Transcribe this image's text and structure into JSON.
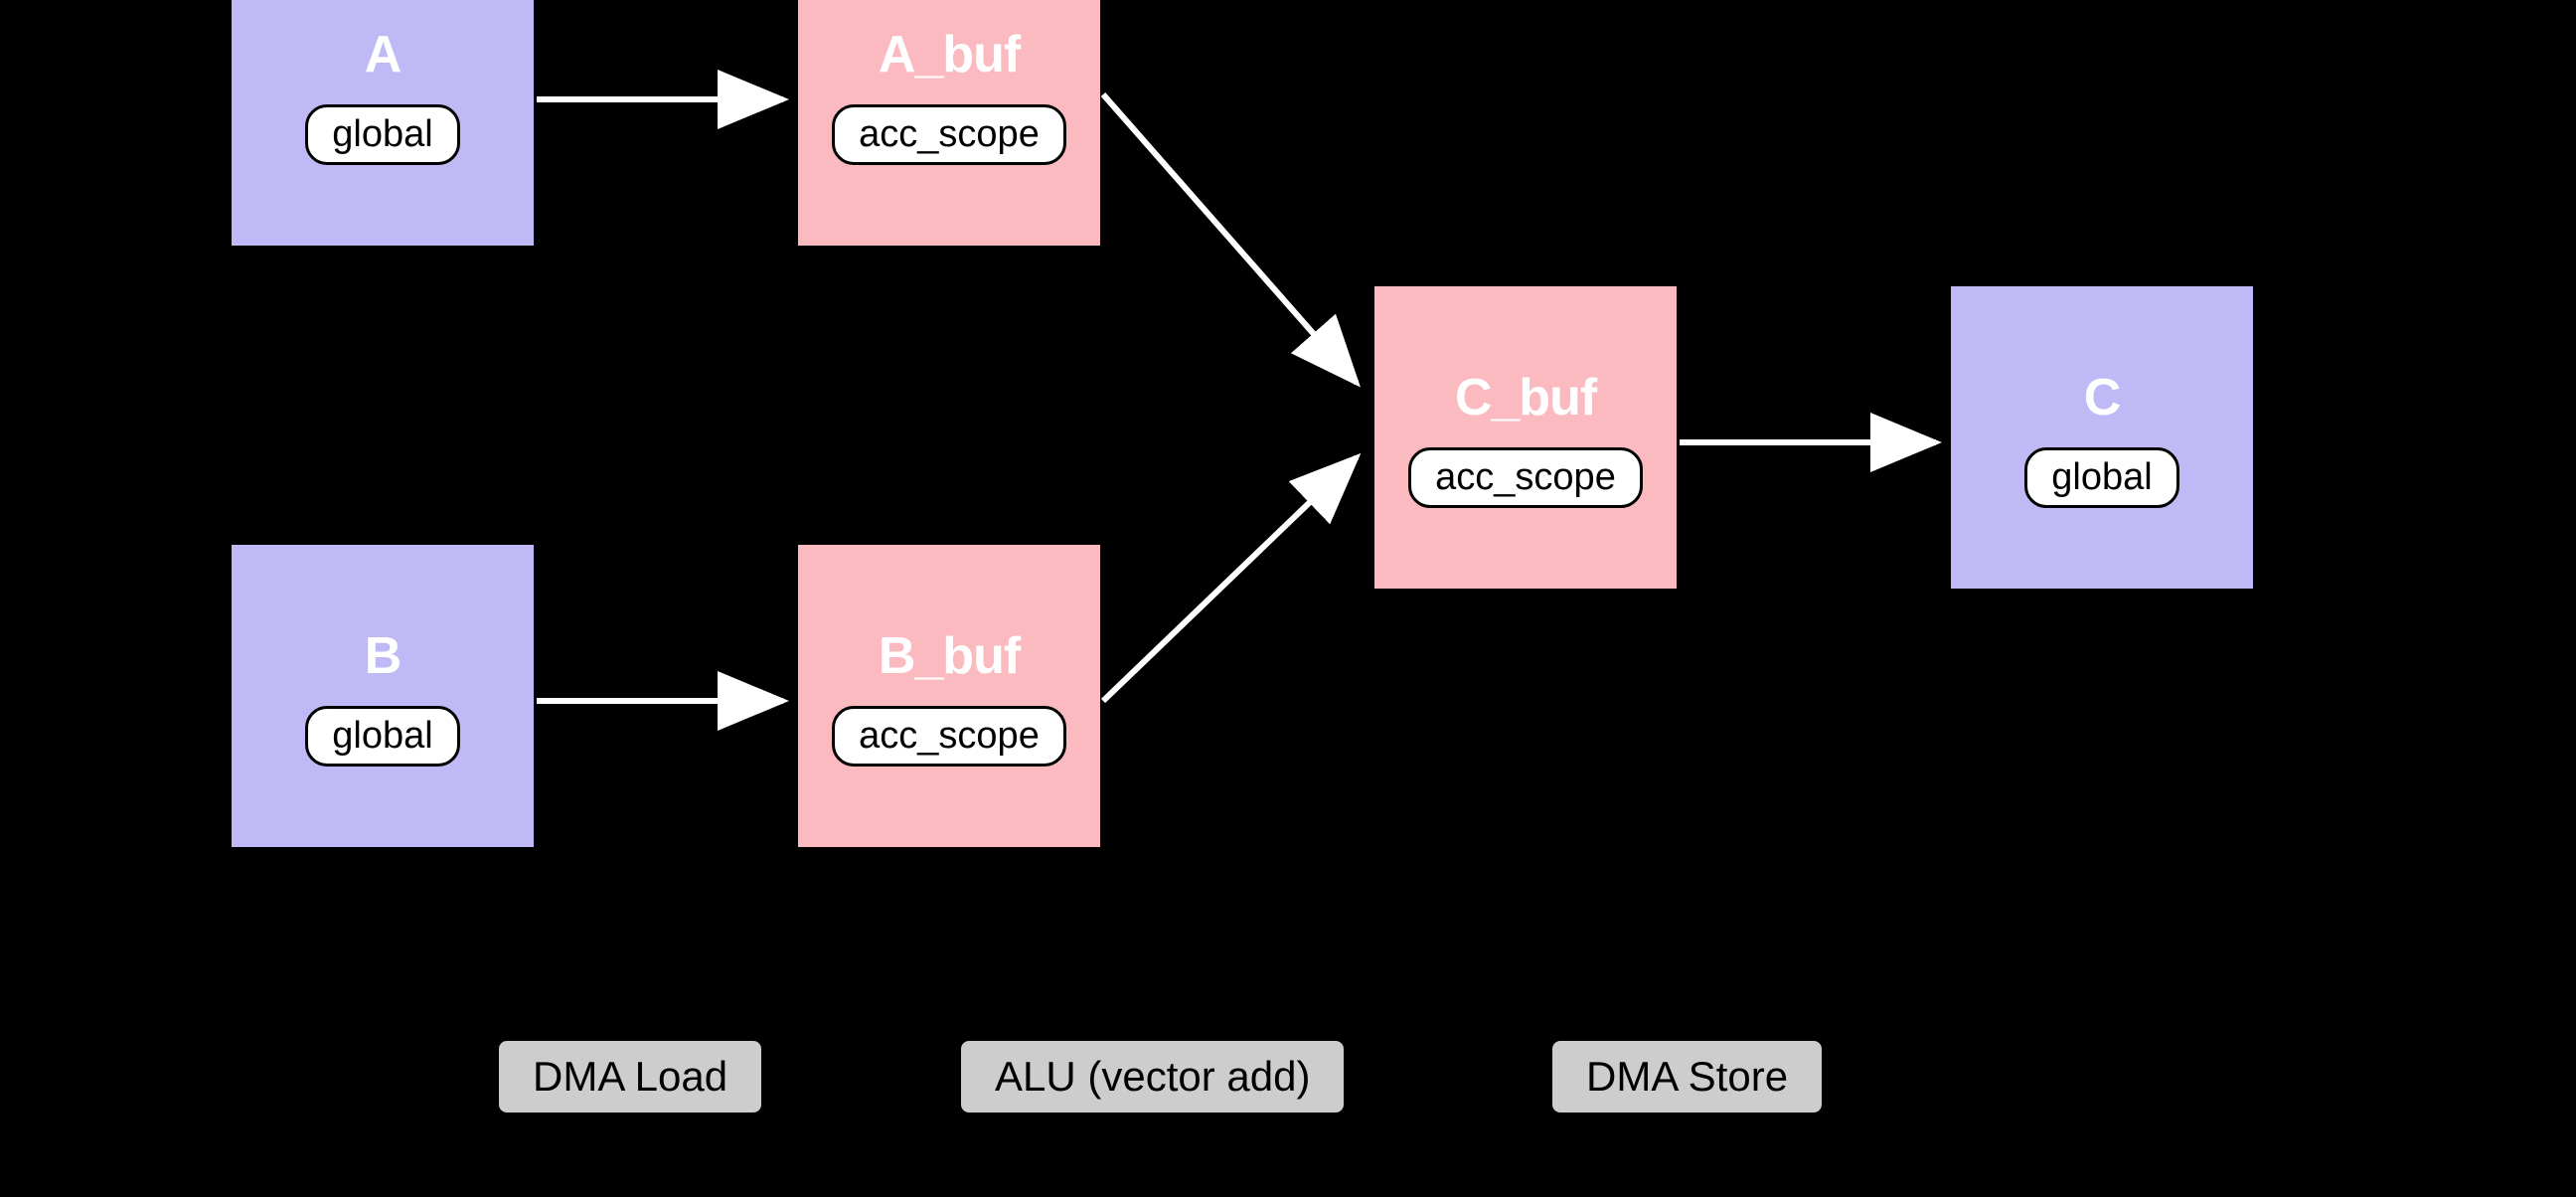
{
  "buffers": {
    "a": {
      "name": "A",
      "scope": "global"
    },
    "a_buf": {
      "name": "A_buf",
      "scope": "acc_scope"
    },
    "b": {
      "name": "B",
      "scope": "global"
    },
    "b_buf": {
      "name": "B_buf",
      "scope": "acc_scope"
    },
    "c_buf": {
      "name": "C_buf",
      "scope": "acc_scope"
    },
    "c": {
      "name": "C",
      "scope": "global"
    }
  },
  "stages": {
    "dma_load": "DMA Load",
    "alu": "ALU (vector add)",
    "dma_store": "DMA Store"
  }
}
